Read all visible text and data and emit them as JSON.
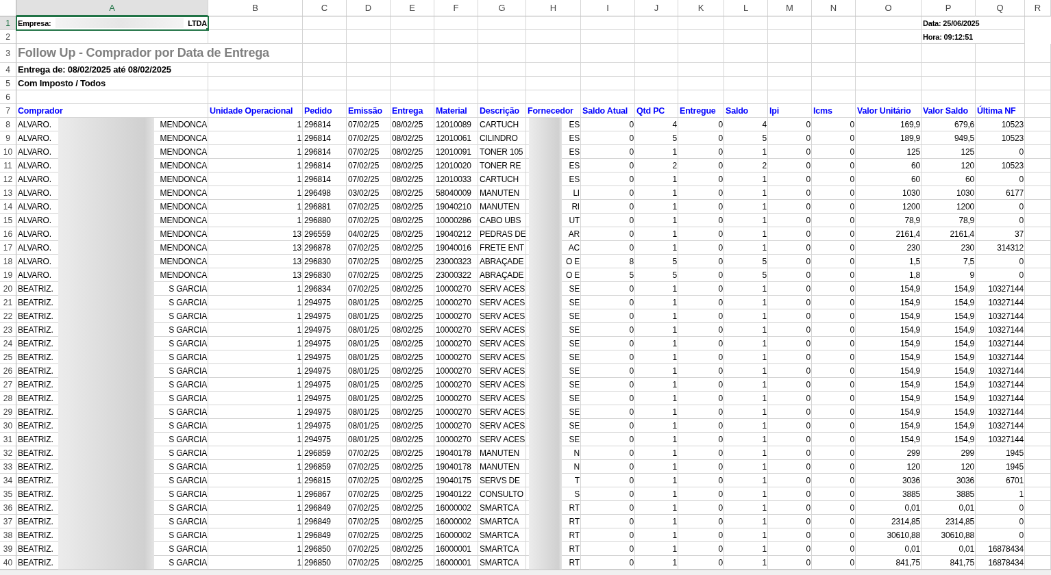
{
  "columns": [
    {
      "label": "A",
      "selected": true
    },
    {
      "label": "B",
      "selected": false
    },
    {
      "label": "C",
      "selected": false
    },
    {
      "label": "D",
      "selected": false
    },
    {
      "label": "E",
      "selected": false
    },
    {
      "label": "F",
      "selected": false
    },
    {
      "label": "G",
      "selected": false
    },
    {
      "label": "H",
      "selected": false
    },
    {
      "label": "I",
      "selected": false
    },
    {
      "label": "J",
      "selected": false
    },
    {
      "label": "K",
      "selected": false
    },
    {
      "label": "L",
      "selected": false
    },
    {
      "label": "M",
      "selected": false
    },
    {
      "label": "N",
      "selected": false
    },
    {
      "label": "O",
      "selected": false
    },
    {
      "label": "P",
      "selected": false
    },
    {
      "label": "Q",
      "selected": false
    },
    {
      "label": "R",
      "selected": false
    }
  ],
  "report": {
    "row_numbers": [
      "1",
      "2",
      "3",
      "4",
      "5",
      "6",
      "7"
    ],
    "empresa": {
      "label": "Empresa:",
      "suffix": "LTDA",
      "selected": true
    },
    "data": "Data: 25/06/2025",
    "hora": "Hora: 09:12:51",
    "title": "Follow Up - Comprador por Data de Entrega",
    "entrega": "Entrega de: 08/02/2025 até 08/02/2025",
    "filtro": "Com Imposto / Todos"
  },
  "headers": [
    "Comprador",
    "Unidade Operacional",
    "Pedido",
    "Emissão",
    "Entrega",
    "Material",
    "Descrição",
    "Fornecedor",
    "Saldo Atual",
    "Qtd PC",
    "Entregue",
    "Saldo",
    "Ipi",
    "Icms",
    "Valor Unitário",
    "Valor Saldo",
    "Última NF"
  ],
  "rows": [
    {
      "number": "8",
      "comprador": [
        "ALVARO.",
        "MENDONCA"
      ],
      "cells": [
        "1",
        "296814",
        "07/02/25",
        "08/02/25",
        "12010089",
        "CARTUCH",
        "ES",
        "0",
        "4",
        "0",
        "4",
        "0",
        "0",
        "169,9",
        "679,6",
        "10523"
      ]
    },
    {
      "number": "9",
      "comprador": [
        "ALVARO.",
        "MENDONCA"
      ],
      "cells": [
        "1",
        "296814",
        "07/02/25",
        "08/02/25",
        "12010061",
        "CILINDRO",
        "ES",
        "0",
        "5",
        "0",
        "5",
        "0",
        "0",
        "189,9",
        "949,5",
        "10523"
      ]
    },
    {
      "number": "10",
      "comprador": [
        "ALVARO.",
        "MENDONCA"
      ],
      "cells": [
        "1",
        "296814",
        "07/02/25",
        "08/02/25",
        "12010091",
        "TONER 105",
        "ES",
        "0",
        "1",
        "0",
        "1",
        "0",
        "0",
        "125",
        "125",
        "0"
      ]
    },
    {
      "number": "11",
      "comprador": [
        "ALVARO.",
        "MENDONCA"
      ],
      "cells": [
        "1",
        "296814",
        "07/02/25",
        "08/02/25",
        "12010020",
        "TONER RE",
        "ES",
        "0",
        "2",
        "0",
        "2",
        "0",
        "0",
        "60",
        "120",
        "10523"
      ]
    },
    {
      "number": "12",
      "comprador": [
        "ALVARO.",
        "MENDONCA"
      ],
      "cells": [
        "1",
        "296814",
        "07/02/25",
        "08/02/25",
        "12010033",
        "CARTUCH",
        "ES",
        "0",
        "1",
        "0",
        "1",
        "0",
        "0",
        "60",
        "60",
        "0"
      ]
    },
    {
      "number": "13",
      "comprador": [
        "ALVARO.",
        "MENDONCA"
      ],
      "cells": [
        "1",
        "296498",
        "03/02/25",
        "08/02/25",
        "58040009",
        "MANUTEN",
        "LI",
        "0",
        "1",
        "0",
        "1",
        "0",
        "0",
        "1030",
        "1030",
        "6177"
      ]
    },
    {
      "number": "14",
      "comprador": [
        "ALVARO.",
        "MENDONCA"
      ],
      "cells": [
        "1",
        "296881",
        "07/02/25",
        "08/02/25",
        "19040210",
        "MANUTEN",
        "RI",
        "0",
        "1",
        "0",
        "1",
        "0",
        "0",
        "1200",
        "1200",
        "0"
      ]
    },
    {
      "number": "15",
      "comprador": [
        "ALVARO.",
        "MENDONCA"
      ],
      "cells": [
        "1",
        "296880",
        "07/02/25",
        "08/02/25",
        "10000286",
        "CABO UBS",
        "UT",
        "0",
        "1",
        "0",
        "1",
        "0",
        "0",
        "78,9",
        "78,9",
        "0"
      ]
    },
    {
      "number": "16",
      "comprador": [
        "ALVARO.",
        "MENDONCA"
      ],
      "cells": [
        "13",
        "296559",
        "04/02/25",
        "08/02/25",
        "19040212",
        "PEDRAS DE",
        "AR",
        "0",
        "1",
        "0",
        "1",
        "0",
        "0",
        "2161,4",
        "2161,4",
        "37"
      ]
    },
    {
      "number": "17",
      "comprador": [
        "ALVARO.",
        "MENDONCA"
      ],
      "cells": [
        "13",
        "296878",
        "07/02/25",
        "08/02/25",
        "19040016",
        "FRETE ENT",
        "AC",
        "0",
        "1",
        "0",
        "1",
        "0",
        "0",
        "230",
        "230",
        "314312"
      ]
    },
    {
      "number": "18",
      "comprador": [
        "ALVARO.",
        "MENDONCA"
      ],
      "cells": [
        "13",
        "296830",
        "07/02/25",
        "08/02/25",
        "23000323",
        "ABRAÇADE",
        "O E",
        "8",
        "5",
        "0",
        "5",
        "0",
        "0",
        "1,5",
        "7,5",
        "0"
      ]
    },
    {
      "number": "19",
      "comprador": [
        "ALVARO.",
        "MENDONCA"
      ],
      "cells": [
        "13",
        "296830",
        "07/02/25",
        "08/02/25",
        "23000322",
        "ABRAÇADE",
        "O E",
        "5",
        "5",
        "0",
        "5",
        "0",
        "0",
        "1,8",
        "9",
        "0"
      ]
    },
    {
      "number": "20",
      "comprador": [
        "BEATRIZ.",
        "S GARCIA"
      ],
      "cells": [
        "1",
        "296834",
        "07/02/25",
        "08/02/25",
        "10000270",
        "SERV ACES",
        "SE",
        "0",
        "1",
        "0",
        "1",
        "0",
        "0",
        "154,9",
        "154,9",
        "10327144"
      ]
    },
    {
      "number": "21",
      "comprador": [
        "BEATRIZ.",
        "S GARCIA"
      ],
      "cells": [
        "1",
        "294975",
        "08/01/25",
        "08/02/25",
        "10000270",
        "SERV ACES",
        "SE",
        "0",
        "1",
        "0",
        "1",
        "0",
        "0",
        "154,9",
        "154,9",
        "10327144"
      ]
    },
    {
      "number": "22",
      "comprador": [
        "BEATRIZ.",
        "S GARCIA"
      ],
      "cells": [
        "1",
        "294975",
        "08/01/25",
        "08/02/25",
        "10000270",
        "SERV ACES",
        "SE",
        "0",
        "1",
        "0",
        "1",
        "0",
        "0",
        "154,9",
        "154,9",
        "10327144"
      ]
    },
    {
      "number": "23",
      "comprador": [
        "BEATRIZ.",
        "S GARCIA"
      ],
      "cells": [
        "1",
        "294975",
        "08/01/25",
        "08/02/25",
        "10000270",
        "SERV ACES",
        "SE",
        "0",
        "1",
        "0",
        "1",
        "0",
        "0",
        "154,9",
        "154,9",
        "10327144"
      ]
    },
    {
      "number": "24",
      "comprador": [
        "BEATRIZ.",
        "S GARCIA"
      ],
      "cells": [
        "1",
        "294975",
        "08/01/25",
        "08/02/25",
        "10000270",
        "SERV ACES",
        "SE",
        "0",
        "1",
        "0",
        "1",
        "0",
        "0",
        "154,9",
        "154,9",
        "10327144"
      ]
    },
    {
      "number": "25",
      "comprador": [
        "BEATRIZ.",
        "S GARCIA"
      ],
      "cells": [
        "1",
        "294975",
        "08/01/25",
        "08/02/25",
        "10000270",
        "SERV ACES",
        "SE",
        "0",
        "1",
        "0",
        "1",
        "0",
        "0",
        "154,9",
        "154,9",
        "10327144"
      ]
    },
    {
      "number": "26",
      "comprador": [
        "BEATRIZ.",
        "S GARCIA"
      ],
      "cells": [
        "1",
        "294975",
        "08/01/25",
        "08/02/25",
        "10000270",
        "SERV ACES",
        "SE",
        "0",
        "1",
        "0",
        "1",
        "0",
        "0",
        "154,9",
        "154,9",
        "10327144"
      ]
    },
    {
      "number": "27",
      "comprador": [
        "BEATRIZ.",
        "S GARCIA"
      ],
      "cells": [
        "1",
        "294975",
        "08/01/25",
        "08/02/25",
        "10000270",
        "SERV ACES",
        "SE",
        "0",
        "1",
        "0",
        "1",
        "0",
        "0",
        "154,9",
        "154,9",
        "10327144"
      ]
    },
    {
      "number": "28",
      "comprador": [
        "BEATRIZ.",
        "S GARCIA"
      ],
      "cells": [
        "1",
        "294975",
        "08/01/25",
        "08/02/25",
        "10000270",
        "SERV ACES",
        "SE",
        "0",
        "1",
        "0",
        "1",
        "0",
        "0",
        "154,9",
        "154,9",
        "10327144"
      ]
    },
    {
      "number": "29",
      "comprador": [
        "BEATRIZ.",
        "S GARCIA"
      ],
      "cells": [
        "1",
        "294975",
        "08/01/25",
        "08/02/25",
        "10000270",
        "SERV ACES",
        "SE",
        "0",
        "1",
        "0",
        "1",
        "0",
        "0",
        "154,9",
        "154,9",
        "10327144"
      ]
    },
    {
      "number": "30",
      "comprador": [
        "BEATRIZ.",
        "S GARCIA"
      ],
      "cells": [
        "1",
        "294975",
        "08/01/25",
        "08/02/25",
        "10000270",
        "SERV ACES",
        "SE",
        "0",
        "1",
        "0",
        "1",
        "0",
        "0",
        "154,9",
        "154,9",
        "10327144"
      ]
    },
    {
      "number": "31",
      "comprador": [
        "BEATRIZ.",
        "S GARCIA"
      ],
      "cells": [
        "1",
        "294975",
        "08/01/25",
        "08/02/25",
        "10000270",
        "SERV ACES",
        "SE",
        "0",
        "1",
        "0",
        "1",
        "0",
        "0",
        "154,9",
        "154,9",
        "10327144"
      ]
    },
    {
      "number": "32",
      "comprador": [
        "BEATRIZ.",
        "S GARCIA"
      ],
      "cells": [
        "1",
        "296859",
        "07/02/25",
        "08/02/25",
        "19040178",
        "MANUTEN",
        "N",
        "0",
        "1",
        "0",
        "1",
        "0",
        "0",
        "299",
        "299",
        "1945"
      ]
    },
    {
      "number": "33",
      "comprador": [
        "BEATRIZ.",
        "S GARCIA"
      ],
      "cells": [
        "1",
        "296859",
        "07/02/25",
        "08/02/25",
        "19040178",
        "MANUTEN",
        "N",
        "0",
        "1",
        "0",
        "1",
        "0",
        "0",
        "120",
        "120",
        "1945"
      ]
    },
    {
      "number": "34",
      "comprador": [
        "BEATRIZ.",
        "S GARCIA"
      ],
      "cells": [
        "1",
        "296815",
        "07/02/25",
        "08/02/25",
        "19040175",
        "SERVS DE",
        "T",
        "0",
        "1",
        "0",
        "1",
        "0",
        "0",
        "3036",
        "3036",
        "6701"
      ]
    },
    {
      "number": "35",
      "comprador": [
        "BEATRIZ.",
        "S GARCIA"
      ],
      "cells": [
        "1",
        "296867",
        "07/02/25",
        "08/02/25",
        "19040122",
        "CONSULTO",
        "S",
        "0",
        "1",
        "0",
        "1",
        "0",
        "0",
        "3885",
        "3885",
        "1"
      ]
    },
    {
      "number": "36",
      "comprador": [
        "BEATRIZ.",
        "S GARCIA"
      ],
      "cells": [
        "1",
        "296849",
        "07/02/25",
        "08/02/25",
        "16000002",
        "SMARTCA",
        "RT",
        "0",
        "1",
        "0",
        "1",
        "0",
        "0",
        "0,01",
        "0,01",
        "0"
      ]
    },
    {
      "number": "37",
      "comprador": [
        "BEATRIZ.",
        "S GARCIA"
      ],
      "cells": [
        "1",
        "296849",
        "07/02/25",
        "08/02/25",
        "16000002",
        "SMARTCA",
        "RT",
        "0",
        "1",
        "0",
        "1",
        "0",
        "0",
        "2314,85",
        "2314,85",
        "0"
      ]
    },
    {
      "number": "38",
      "comprador": [
        "BEATRIZ.",
        "S GARCIA"
      ],
      "cells": [
        "1",
        "296849",
        "07/02/25",
        "08/02/25",
        "16000002",
        "SMARTCA",
        "RT",
        "0",
        "1",
        "0",
        "1",
        "0",
        "0",
        "30610,88",
        "30610,88",
        "0"
      ]
    },
    {
      "number": "39",
      "comprador": [
        "BEATRIZ.",
        "S GARCIA"
      ],
      "cells": [
        "1",
        "296850",
        "07/02/25",
        "08/02/25",
        "16000001",
        "SMARTCA",
        "RT",
        "0",
        "1",
        "0",
        "1",
        "0",
        "0",
        "0,01",
        "0,01",
        "16878434"
      ]
    },
    {
      "number": "40",
      "comprador": [
        "BEATRIZ.",
        "S GARCIA"
      ],
      "cells": [
        "1",
        "296850",
        "07/02/25",
        "08/02/25",
        "16000001",
        "SMARTCA",
        "RT",
        "0",
        "1",
        "0",
        "1",
        "0",
        "0",
        "841,75",
        "841,75",
        "16878434"
      ]
    }
  ]
}
